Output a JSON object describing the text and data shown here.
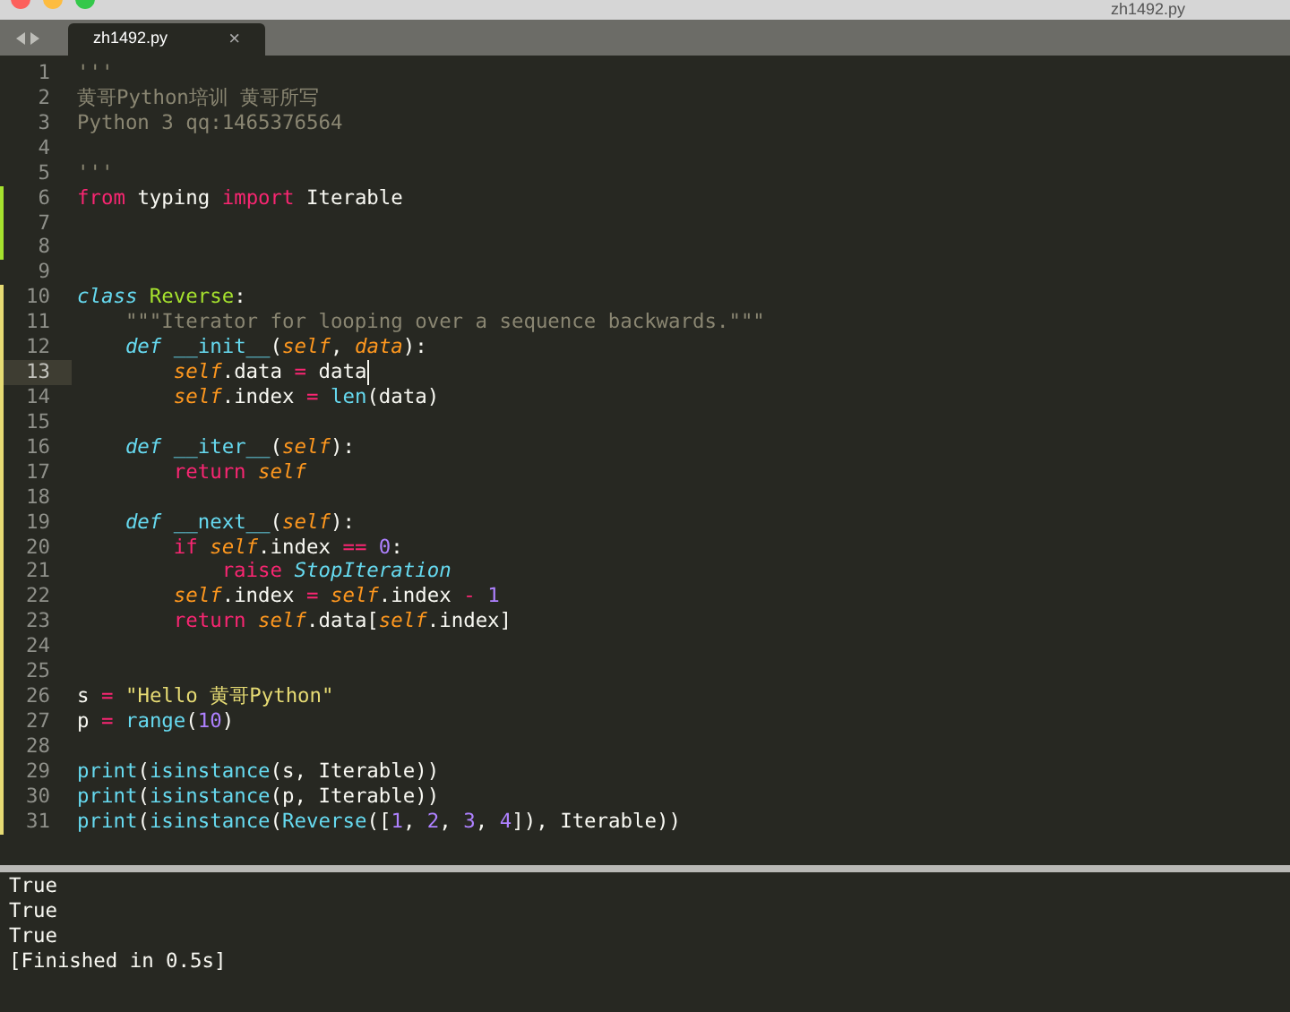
{
  "window": {
    "title": "zh1492.py"
  },
  "tabs": [
    {
      "label": "zh1492.py",
      "close": "×",
      "selected": true
    }
  ],
  "lines": [
    {
      "number": "1",
      "added": false,
      "modified": false,
      "current": false,
      "tokens": [
        {
          "text": "'''",
          "kind": "comment"
        }
      ]
    },
    {
      "number": "2",
      "added": false,
      "modified": false,
      "current": false,
      "tokens": [
        {
          "text": "黄哥Python培训 黄哥所写",
          "kind": "comment"
        }
      ]
    },
    {
      "number": "3",
      "added": false,
      "modified": false,
      "current": false,
      "tokens": [
        {
          "text": "Python 3 qq:1465376564",
          "kind": "comment"
        }
      ]
    },
    {
      "number": "4",
      "added": false,
      "modified": false,
      "current": false
    },
    {
      "number": "5",
      "added": false,
      "modified": false,
      "current": false,
      "tokens": [
        {
          "text": "'''",
          "kind": "comment"
        }
      ]
    },
    {
      "number": "6",
      "added": true,
      "modified": false,
      "current": false,
      "tokens": [
        {
          "text": "from",
          "kind": "keyword"
        },
        {
          "text": " typing ",
          "kind": "plain"
        },
        {
          "text": "import",
          "kind": "keyword"
        },
        {
          "text": " Iterable",
          "kind": "plain"
        }
      ]
    },
    {
      "number": "7",
      "added": true,
      "modified": false,
      "current": false
    },
    {
      "number": "8",
      "added": true,
      "modified": false,
      "current": false
    },
    {
      "number": "9",
      "added": false,
      "modified": false,
      "current": false
    },
    {
      "number": "10",
      "added": false,
      "modified": true,
      "current": false,
      "tokens": [
        {
          "text": "class ",
          "kind": "storage"
        },
        {
          "text": "Reverse",
          "kind": "classname"
        },
        {
          "text": ":",
          "kind": "plain"
        }
      ]
    },
    {
      "number": "11",
      "added": false,
      "modified": true,
      "current": false,
      "tokens": [
        {
          "text": "    \"\"\"Iterator for looping over a sequence backwards.\"\"\"",
          "kind": "comment"
        }
      ]
    },
    {
      "number": "12",
      "added": false,
      "modified": true,
      "current": false,
      "tokens": [
        {
          "text": "    def ",
          "kind": "storage"
        },
        {
          "text": "__init__",
          "kind": "function"
        },
        {
          "text": "(",
          "kind": "plain"
        },
        {
          "text": "self",
          "kind": "self"
        },
        {
          "text": ", ",
          "kind": "plain"
        },
        {
          "text": "data",
          "kind": "self"
        },
        {
          "text": "):",
          "kind": "plain"
        }
      ]
    },
    {
      "number": "13",
      "added": false,
      "modified": true,
      "current": true,
      "tokens": [
        {
          "text": "        self",
          "kind": "self"
        },
        {
          "text": ".data ",
          "kind": "plain"
        },
        {
          "text": "=",
          "kind": "operator"
        },
        {
          "text": " data",
          "kind": "plain"
        }
      ]
    },
    {
      "number": "14",
      "added": false,
      "modified": true,
      "current": false,
      "tokens": [
        {
          "text": "        self",
          "kind": "self"
        },
        {
          "text": ".index ",
          "kind": "plain"
        },
        {
          "text": "=",
          "kind": "operator"
        },
        {
          "text": " len",
          "kind": "function"
        },
        {
          "text": "(data)",
          "kind": "plain"
        }
      ]
    },
    {
      "number": "15",
      "added": false,
      "modified": true,
      "current": false
    },
    {
      "number": "16",
      "added": false,
      "modified": true,
      "current": false,
      "tokens": [
        {
          "text": "    def ",
          "kind": "storage"
        },
        {
          "text": "__iter__",
          "kind": "function"
        },
        {
          "text": "(",
          "kind": "plain"
        },
        {
          "text": "self",
          "kind": "self"
        },
        {
          "text": "):",
          "kind": "plain"
        }
      ]
    },
    {
      "number": "17",
      "added": false,
      "modified": true,
      "current": false,
      "tokens": [
        {
          "text": "        return ",
          "kind": "keyword"
        },
        {
          "text": "self",
          "kind": "self"
        }
      ]
    },
    {
      "number": "18",
      "added": false,
      "modified": true,
      "current": false
    },
    {
      "number": "19",
      "added": false,
      "modified": true,
      "current": false,
      "tokens": [
        {
          "text": "    def ",
          "kind": "storage"
        },
        {
          "text": "__next__",
          "kind": "function"
        },
        {
          "text": "(",
          "kind": "plain"
        },
        {
          "text": "self",
          "kind": "self"
        },
        {
          "text": "):",
          "kind": "plain"
        }
      ]
    },
    {
      "number": "20",
      "added": false,
      "modified": true,
      "current": false,
      "tokens": [
        {
          "text": "        if ",
          "kind": "keyword"
        },
        {
          "text": "self",
          "kind": "self"
        },
        {
          "text": ".index ",
          "kind": "plain"
        },
        {
          "text": "== ",
          "kind": "operator"
        },
        {
          "text": "0",
          "kind": "number"
        },
        {
          "text": ":",
          "kind": "plain"
        }
      ]
    },
    {
      "number": "21",
      "added": false,
      "modified": true,
      "current": false,
      "tokens": [
        {
          "text": "            raise ",
          "kind": "keyword"
        },
        {
          "text": "StopIteration",
          "kind": "exception"
        }
      ]
    },
    {
      "number": "22",
      "added": false,
      "modified": true,
      "current": false,
      "tokens": [
        {
          "text": "        self",
          "kind": "self"
        },
        {
          "text": ".index ",
          "kind": "plain"
        },
        {
          "text": "= ",
          "kind": "operator"
        },
        {
          "text": "self",
          "kind": "self"
        },
        {
          "text": ".index ",
          "kind": "plain"
        },
        {
          "text": "- ",
          "kind": "operator"
        },
        {
          "text": "1",
          "kind": "number"
        }
      ]
    },
    {
      "number": "23",
      "added": false,
      "modified": true,
      "current": false,
      "tokens": [
        {
          "text": "        return ",
          "kind": "keyword"
        },
        {
          "text": "self",
          "kind": "self"
        },
        {
          "text": ".data[",
          "kind": "plain"
        },
        {
          "text": "self",
          "kind": "self"
        },
        {
          "text": ".index]",
          "kind": "plain"
        }
      ]
    },
    {
      "number": "24",
      "added": false,
      "modified": true,
      "current": false
    },
    {
      "number": "25",
      "added": false,
      "modified": true,
      "current": false
    },
    {
      "number": "26",
      "added": false,
      "modified": true,
      "current": false,
      "tokens": [
        {
          "text": "s ",
          "kind": "plain"
        },
        {
          "text": "= ",
          "kind": "operator"
        },
        {
          "text": "\"Hello 黄哥Python\"",
          "kind": "string"
        }
      ]
    },
    {
      "number": "27",
      "added": false,
      "modified": true,
      "current": false,
      "tokens": [
        {
          "text": "p ",
          "kind": "plain"
        },
        {
          "text": "= ",
          "kind": "operator"
        },
        {
          "text": "range",
          "kind": "function"
        },
        {
          "text": "(",
          "kind": "plain"
        },
        {
          "text": "10",
          "kind": "number"
        },
        {
          "text": ")",
          "kind": "plain"
        }
      ]
    },
    {
      "number": "28",
      "added": false,
      "modified": true,
      "current": false
    },
    {
      "number": "29",
      "added": false,
      "modified": true,
      "current": false,
      "tokens": [
        {
          "text": "print",
          "kind": "function"
        },
        {
          "text": "(",
          "kind": "plain"
        },
        {
          "text": "isinstance",
          "kind": "function"
        },
        {
          "text": "(s, Iterable))",
          "kind": "plain"
        }
      ]
    },
    {
      "number": "30",
      "added": false,
      "modified": true,
      "current": false,
      "tokens": [
        {
          "text": "print",
          "kind": "function"
        },
        {
          "text": "(",
          "kind": "plain"
        },
        {
          "text": "isinstance",
          "kind": "function"
        },
        {
          "text": "(p, Iterable))",
          "kind": "plain"
        }
      ]
    },
    {
      "number": "31",
      "added": false,
      "modified": true,
      "current": false,
      "tokens": [
        {
          "text": "print",
          "kind": "function"
        },
        {
          "text": "(",
          "kind": "plain"
        },
        {
          "text": "isinstance",
          "kind": "function"
        },
        {
          "text": "(",
          "kind": "plain"
        },
        {
          "text": "Reverse",
          "kind": "function"
        },
        {
          "text": "([",
          "kind": "plain"
        },
        {
          "text": "1",
          "kind": "number"
        },
        {
          "text": ", ",
          "kind": "plain"
        },
        {
          "text": "2",
          "kind": "number"
        },
        {
          "text": ", ",
          "kind": "plain"
        },
        {
          "text": "3",
          "kind": "number"
        },
        {
          "text": ", ",
          "kind": "plain"
        },
        {
          "text": "4",
          "kind": "number"
        },
        {
          "text": "]), Iterable))",
          "kind": "plain"
        }
      ]
    }
  ],
  "output": [
    "True",
    "True",
    "True",
    "[Finished in 0.5s]"
  ]
}
